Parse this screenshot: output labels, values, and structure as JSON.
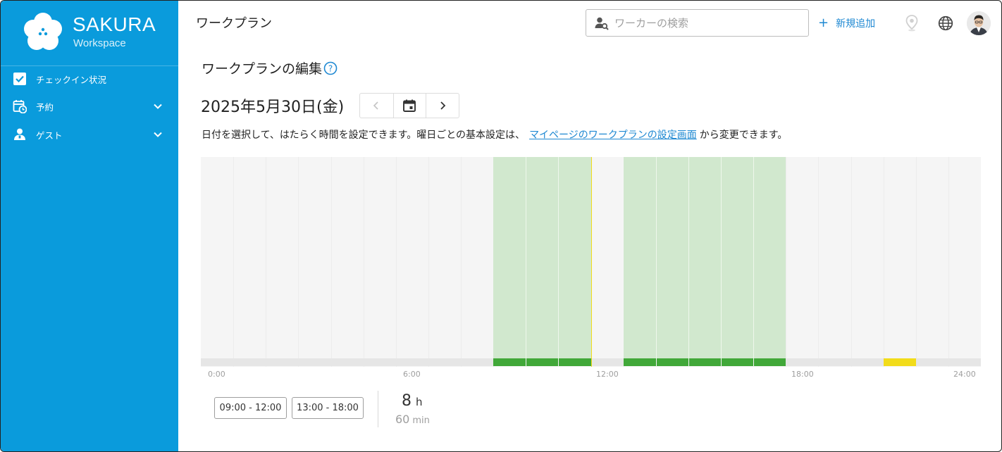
{
  "app": {
    "brand_name": "SAKURA",
    "brand_sub": "Workspace",
    "accent": "#0a9bdc"
  },
  "sidebar": {
    "items": [
      {
        "label": "チェックイン状況",
        "icon": "checkbox-icon",
        "expandable": false
      },
      {
        "label": "予約",
        "icon": "calendar-clock-icon",
        "expandable": true
      },
      {
        "label": "ゲスト",
        "icon": "guest-icon",
        "expandable": true
      }
    ]
  },
  "header": {
    "title": "ワークプラン",
    "search_placeholder": "ワーカーの検索",
    "add_label": "新規追加",
    "add_symbol": "+"
  },
  "main": {
    "section_title": "ワークプランの編集",
    "date_label": "2025年5月30日(金)",
    "desc_before": "日付を選択して、はたらく時間を設定できます。曜日ごとの基本設定は、",
    "desc_link": "マイページのワークプランの設定画面",
    "desc_after": "から変更できます。"
  },
  "timeline": {
    "tick_labels": [
      "0:00",
      "6:00",
      "12:00",
      "18:00",
      "24:00"
    ],
    "slot_minutes": 30,
    "working_slots": [
      9,
      10,
      11,
      13,
      14,
      15,
      16,
      17
    ],
    "highlight_slot": 21,
    "working_color": "#41a839",
    "working_fill": "#d1e8ce",
    "highlight_color": "#f2dc1a"
  },
  "ranges": [
    "09:00 - 12:00",
    "13:00 - 18:00"
  ],
  "summary": {
    "hours": "8",
    "hours_unit": "h",
    "minutes": "60",
    "minutes_unit": "min"
  }
}
